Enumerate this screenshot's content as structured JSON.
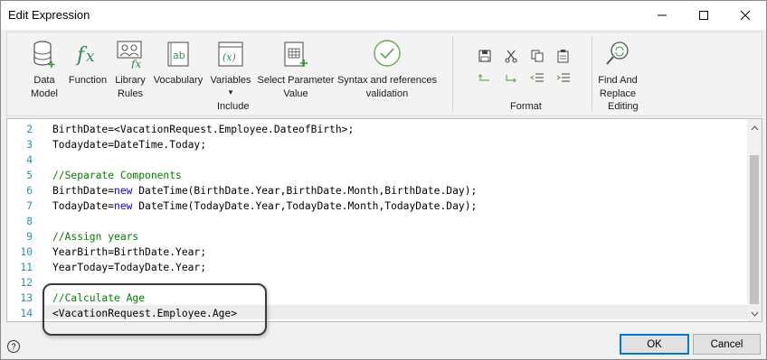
{
  "window": {
    "title": "Edit Expression"
  },
  "ribbon": {
    "include": {
      "label": "Include",
      "buttons": [
        {
          "icon": "data-model-icon",
          "label_line1": "Data",
          "label_line2": "Model"
        },
        {
          "icon": "function-icon",
          "label_line1": "Function",
          "label_line2": ""
        },
        {
          "icon": "library-rules-icon",
          "label_line1": "Library",
          "label_line2": "Rules"
        },
        {
          "icon": "vocabulary-icon",
          "label_line1": "Vocabulary",
          "label_line2": ""
        },
        {
          "icon": "variables-icon",
          "label_line1": "Variables",
          "label_line2": "▾"
        },
        {
          "icon": "select-parameter-icon",
          "label_line1": "Select Parameter",
          "label_line2": "Value"
        },
        {
          "icon": "syntax-validation-icon",
          "label_line1": "Syntax and references",
          "label_line2": "validation"
        }
      ]
    },
    "format": {
      "label": "Format",
      "icons": [
        "save-icon",
        "cut-icon",
        "copy-icon",
        "paste-icon",
        "undo-icon",
        "redo-icon",
        "outdent-icon",
        "indent-icon"
      ]
    },
    "editing": {
      "label": "Editing",
      "find_replace_line1": "Find And",
      "find_replace_line2": "Replace"
    }
  },
  "editor": {
    "lines": [
      {
        "num": "2",
        "text": "BirthDate=<VacationRequest.Employee.DateofBirth>;",
        "type": "code"
      },
      {
        "num": "3",
        "text": "Todaydate=DateTime.Today;",
        "type": "code"
      },
      {
        "num": "4",
        "text": "",
        "type": "code"
      },
      {
        "num": "5",
        "text": "//Separate Components",
        "type": "comment"
      },
      {
        "num": "6",
        "text": "BirthDate=new DateTime(BirthDate.Year,BirthDate.Month,BirthDate.Day);",
        "type": "code"
      },
      {
        "num": "7",
        "text": "TodayDate=new DateTime(TodayDate.Year,TodayDate.Month,TodayDate.Day);",
        "type": "code"
      },
      {
        "num": "8",
        "text": "",
        "type": "code"
      },
      {
        "num": "9",
        "text": "//Assign years",
        "type": "comment"
      },
      {
        "num": "10",
        "text": "YearBirth=BirthDate.Year;",
        "type": "code"
      },
      {
        "num": "11",
        "text": "YearToday=TodayDate.Year;",
        "type": "code"
      },
      {
        "num": "12",
        "text": "",
        "type": "code"
      },
      {
        "num": "13",
        "text": "//Calculate Age",
        "type": "comment"
      },
      {
        "num": "14",
        "text": "<VacationRequest.Employee.Age>",
        "type": "code"
      }
    ]
  },
  "footer": {
    "help_label": "?",
    "ok_label": "OK",
    "cancel_label": "Cancel"
  },
  "colors": {
    "line_number": "#2b91af",
    "comment": "#008000",
    "keyword": "#0000ff",
    "accent": "#0078d7"
  }
}
